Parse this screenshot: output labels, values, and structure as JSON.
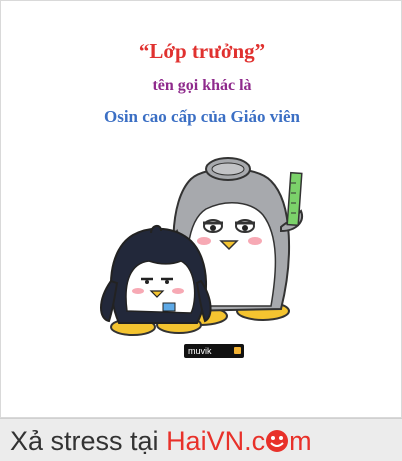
{
  "caption": {
    "title": "“Lớp trưởng”",
    "line2": "tên gọi khác là",
    "line3": "Osin cao cấp của Giáo viên"
  },
  "brand_tag": "muvik",
  "footer": {
    "prefix": "Xả stress tại ",
    "site_a": "HaiVN.c",
    "site_b": "m"
  },
  "colors": {
    "title": "#e0312f",
    "line2": "#8f2a8c",
    "line3": "#3b6fc4",
    "footer_accent": "#e8312a"
  }
}
